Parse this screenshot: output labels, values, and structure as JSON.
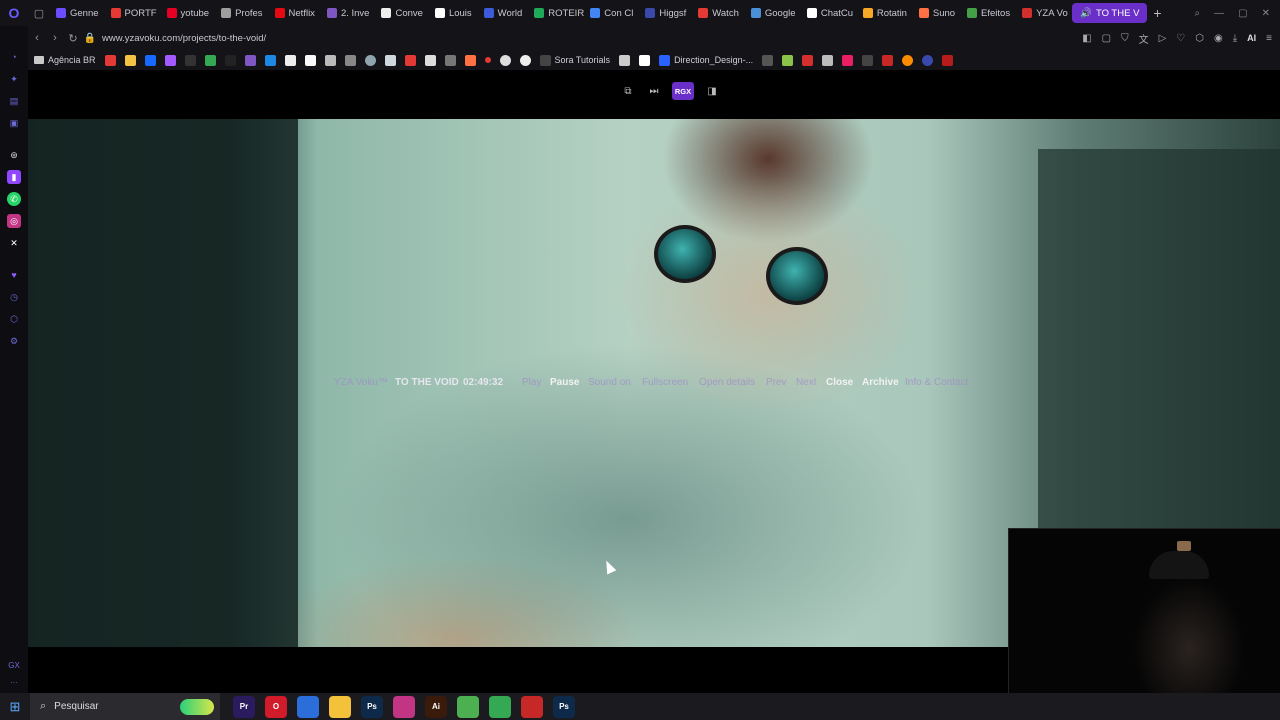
{
  "tabs": [
    {
      "label": "Genne",
      "color": "#6b4cff"
    },
    {
      "label": "PORTF",
      "color": "#e53935"
    },
    {
      "label": "yotube",
      "color": "#e60023"
    },
    {
      "label": "Profes",
      "color": "#9e9e9e"
    },
    {
      "label": "Netflix",
      "color": "#e50914"
    },
    {
      "label": "2. Inve",
      "color": "#7e57c2"
    },
    {
      "label": "Conve",
      "color": "#eeeeee"
    },
    {
      "label": "Louis",
      "color": "#ffffff"
    },
    {
      "label": "World",
      "color": "#3b5bdb"
    },
    {
      "label": "ROTEIR",
      "color": "#1faa59"
    },
    {
      "label": "Con Cl",
      "color": "#4285f4"
    },
    {
      "label": "Higgsf",
      "color": "#3949ab"
    },
    {
      "label": "Watch",
      "color": "#e53935"
    },
    {
      "label": "Google",
      "color": "#4a90d9"
    },
    {
      "label": "ChatCu",
      "color": "#ffffff"
    },
    {
      "label": "Rotatin",
      "color": "#f9a825"
    },
    {
      "label": "Suno",
      "color": "#ff7043"
    },
    {
      "label": "Efeitos",
      "color": "#43a047"
    },
    {
      "label": "YZA Vo",
      "color": "#d32f2f"
    }
  ],
  "active_tab": {
    "label": "TO THE V",
    "color": "#6a2fc8"
  },
  "new_tab_label": "+",
  "address": {
    "url": "www.yzavoku.com/projects/to-the-void/",
    "ai_label": "AI"
  },
  "bookmarks": [
    {
      "label": "Agência BR",
      "type": "folder"
    },
    {
      "label": "Sora Tutorials",
      "type": "link",
      "color": "#444444"
    },
    {
      "label": "Direction_Design-...",
      "type": "link",
      "color": "#2962ff"
    }
  ],
  "video_controls": {
    "rgx_label": "RGX"
  },
  "video_nav": {
    "brand": "YZA Voku™",
    "title": "TO THE VOID",
    "timecode": "02:49:32",
    "play": "Play",
    "pause": "Pause",
    "sound": "Sound on",
    "fullscreen": "Fullscreen",
    "open_details": "Open details",
    "prev": "Prev",
    "next": "Next",
    "close": "Close",
    "archive": "Archive",
    "info_contact": "Info & Contact"
  },
  "taskbar": {
    "search_label": "Pesquisar",
    "apps": [
      {
        "name": "premiere",
        "label": "Pr",
        "color": "#2a1a5e"
      },
      {
        "name": "opera",
        "label": "O",
        "color": "#d11a2a"
      },
      {
        "name": "store",
        "label": "",
        "color": "#2b6ed9"
      },
      {
        "name": "explorer",
        "label": "",
        "color": "#f3c13a"
      },
      {
        "name": "photoshop",
        "label": "Ps",
        "color": "#0d2a4a"
      },
      {
        "name": "instagram",
        "label": "",
        "color": "#c13584"
      },
      {
        "name": "illustrator",
        "label": "Ai",
        "color": "#3a1a0a"
      },
      {
        "name": "green-app",
        "label": "",
        "color": "#4caf50"
      },
      {
        "name": "chrome",
        "label": "",
        "color": "#34a853"
      },
      {
        "name": "capture",
        "label": "",
        "color": "#c62828"
      },
      {
        "name": "photoshop-2",
        "label": "Ps",
        "color": "#0d2a4a"
      }
    ]
  }
}
